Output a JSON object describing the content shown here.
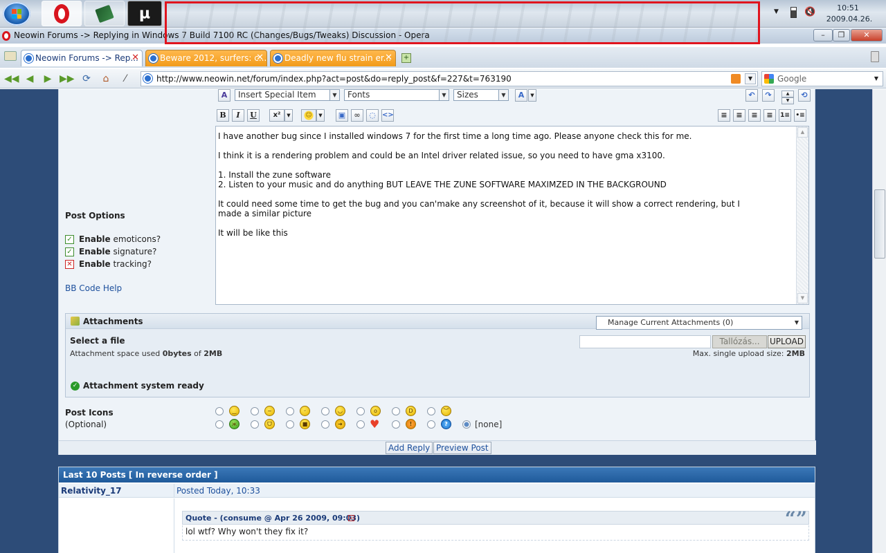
{
  "taskbar": {
    "apps": [
      "opera-icon",
      "book-icon",
      "utorrent-icon"
    ],
    "clock_time": "10:51",
    "clock_date": "2009.04.26."
  },
  "window": {
    "title": "Neowin Forums -> Replying in Windows 7 Build 7100 RC (Changes/Bugs/Tweaks) Discussion - Opera",
    "minimize": "–",
    "maximize": "❐",
    "close": "✕"
  },
  "tabs": [
    {
      "label": "Neowin Forums -> Rep...",
      "active": true
    },
    {
      "label": "Beware 2012, surfers: c...",
      "active": false
    },
    {
      "label": "Deadly new flu strain er...",
      "active": false
    }
  ],
  "nav": {
    "url": "http://www.neowin.net/forum/index.php?act=post&do=reply_post&f=227&t=763190",
    "search_engine": "Google"
  },
  "editor": {
    "special_item": "Insert Special Item",
    "fonts": "Fonts",
    "sizes": "Sizes",
    "bold": "B",
    "italic": "I",
    "underline": "U",
    "superscript": "x²",
    "lines": [
      "I have another bug since I installed windows 7 for the first time a long time ago. Please anyone check this for me.",
      "I think it is a rendering problem and could be an Intel driver related issue, so you need to have gma x3100.",
      "1. Install the zune software",
      "2. Listen to your music and do anything BUT LEAVE THE ZUNE SOFTWARE MAXIMZED IN THE BACKGROUND",
      "It could need some time to get the bug and you can'make any screenshot of it, because it will show a correct rendering, but I",
      "made a similar picture",
      "It will be like this"
    ]
  },
  "post_options": {
    "header": "Post Options",
    "items": [
      {
        "bold": "Enable",
        "rest": " emoticons?",
        "checked": true
      },
      {
        "bold": "Enable",
        "rest": " signature?",
        "checked": true
      },
      {
        "bold": "Enable",
        "rest": " tracking?",
        "checked": false
      }
    ],
    "bbcode_help": "BB Code Help"
  },
  "attachments": {
    "header": "Attachments",
    "manage": "Manage Current Attachments (0)",
    "select_file": "Select a file",
    "space_prefix": "Attachment space used ",
    "space_used": "0bytes",
    "space_mid": " of ",
    "space_total": "2MB",
    "max_label": "Max. single upload size: ",
    "max_value": "2MB",
    "browse": "Tallózás...",
    "upload": "UPLOAD",
    "ready": "Attachment system ready"
  },
  "post_icons": {
    "header": "Post Icons",
    "optional": "(Optional)",
    "none_label": "[none]"
  },
  "buttons": {
    "add_reply": "Add Reply",
    "preview": "Preview Post"
  },
  "last_posts": {
    "header": "Last 10 Posts [ In reverse order ]",
    "author": "Relativity_17",
    "posted": "Posted Today, 10:33",
    "quote_header": "Quote - (consume @ Apr 26 2009, 09:03)",
    "quote_text": "lol wtf? Why won't they fix it?"
  }
}
